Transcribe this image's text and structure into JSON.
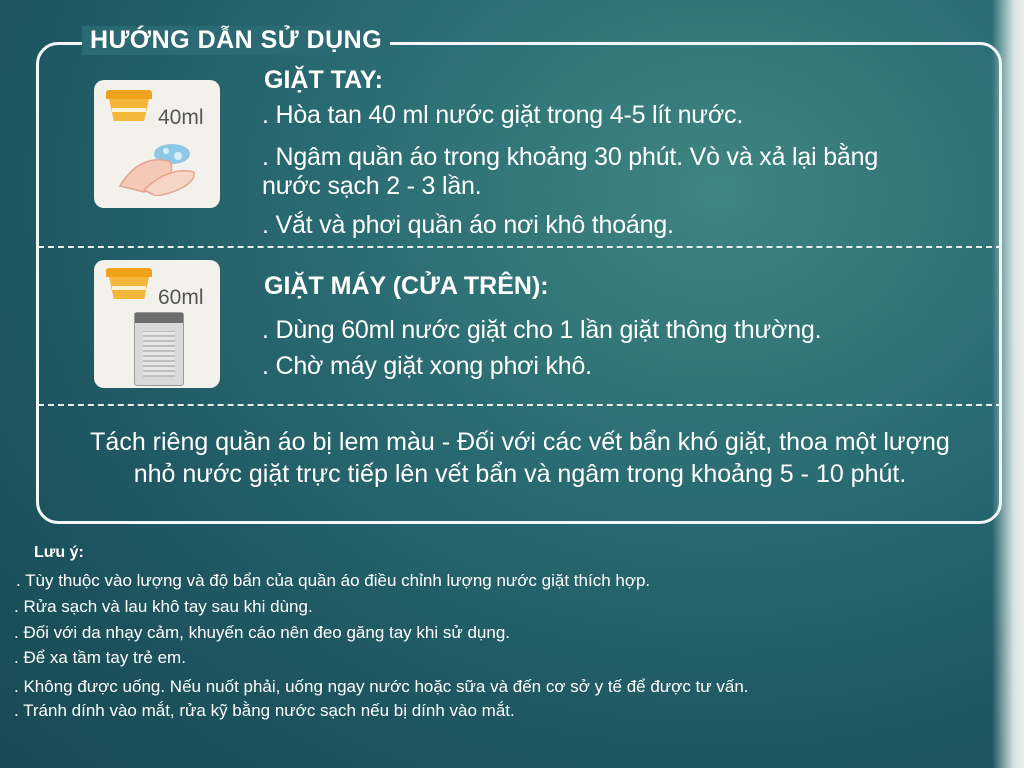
{
  "title": "HƯỚNG DẪN SỬ DỤNG",
  "hand_wash": {
    "heading": "GIẶT TAY:",
    "cup_label": "40ml",
    "lines": [
      ". Hòa tan 40 ml nước giặt trong 4-5 lít nước.",
      ". Ngâm quần áo trong khoảng 30 phút. Vò và xả lại bằng",
      "nước sạch 2 - 3 lần.",
      ". Vắt và phơi quần áo nơi khô thoáng."
    ]
  },
  "machine_wash": {
    "heading": "GIẶT MÁY (CỬA TRÊN):",
    "cup_label": "60ml",
    "lines": [
      ". Dùng 60ml nước giặt cho 1 lần giặt thông thường.",
      ". Chờ máy giặt xong phơi khô."
    ]
  },
  "tip": [
    "Tách riêng quần áo bị lem màu - Đối với các vết bẩn khó giặt, thoa một lượng",
    "nhỏ nước giặt trực tiếp lên vết bẩn và ngâm trong khoảng 5 - 10 phút."
  ],
  "notes": {
    "title": "Lưu ý:",
    "items": [
      ". Tùy thuộc vào lượng và độ bẩn của quần áo điều chỉnh lượng nước giặt thích hợp.",
      ". Rửa sạch và lau khô tay sau khi dùng.",
      ". Đối với da nhạy cảm, khuyến cáo nên đeo găng tay khi sử dụng.",
      ". Để xa tầm tay trẻ em.",
      ". Không được uống. Nếu nuốt phải, uống ngay nước hoặc sữa và đến cơ sở y tế để được tư vấn.",
      ". Tránh dính vào mắt, rửa kỹ bằng nước sạch nếu bị dính vào mắt."
    ]
  }
}
